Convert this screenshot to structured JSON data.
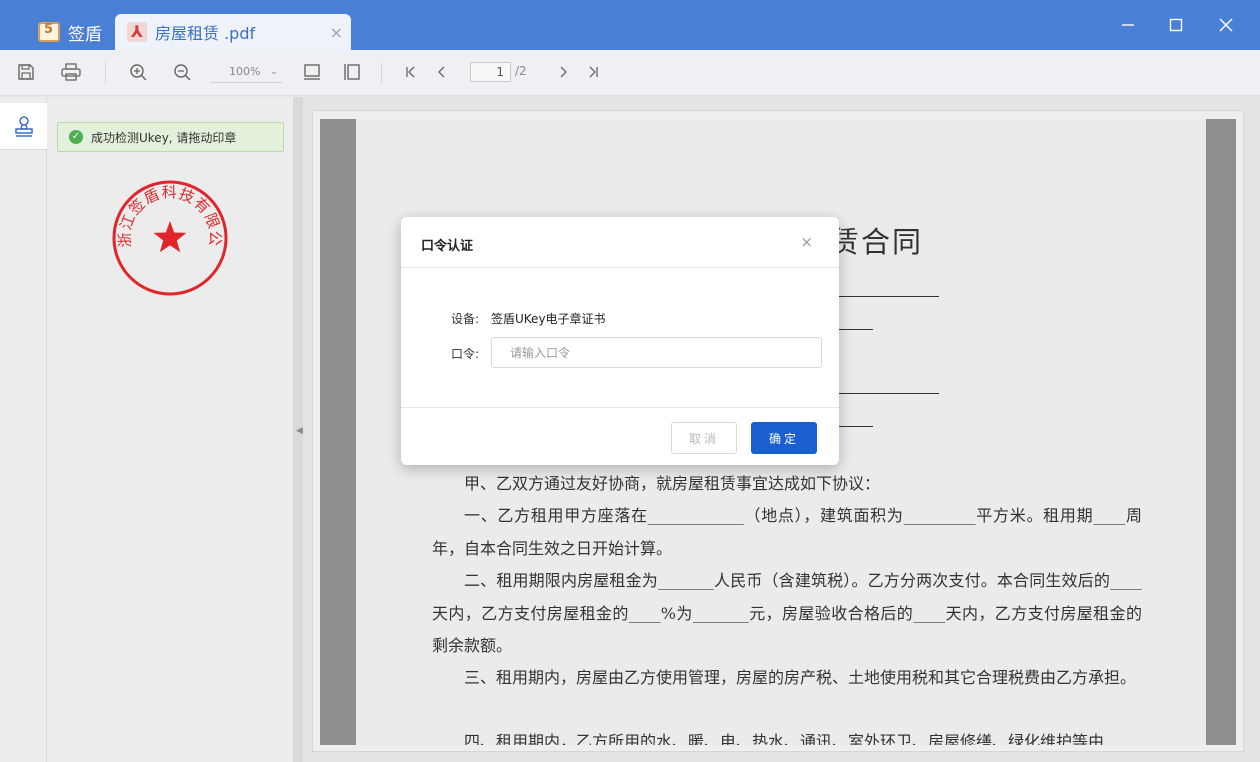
{
  "titlebar": {
    "app_name": "签盾",
    "tab_title": "房屋租赁 .pdf",
    "tab_close": "×",
    "minimize": "—",
    "maximize": "☐",
    "close": "✕"
  },
  "toolbar": {
    "zoom": "100%",
    "page_current": "1",
    "page_total": "/2",
    "icons": [
      "save-icon",
      "print-icon",
      "zoom-in-icon",
      "zoom-out-icon",
      "fit-width-icon",
      "fit-height-icon",
      "first-page-icon",
      "prev-page-icon",
      "next-page-icon",
      "last-page-icon"
    ]
  },
  "sidebar": {
    "alert": "成功检测Ukey, 请拖动印章",
    "seal_text": "浙江签盾科技有限公司",
    "seal_color": "#e0262b"
  },
  "document": {
    "title_fragment": "赁合同",
    "paragraphs": [
      "甲、乙双方通过友好协商，就房屋租赁事宜达成如下协议：",
      "一、乙方租用甲方座落在____________（地点），建筑面积为_________平方米。租用期____周年，自本合同生效之日开始计算。",
      "二、租用期限内房屋租金为_______人民币（含建筑税）。乙方分两次支付。本合同生效后的____天内，乙方支付房屋租金的____%为_______元，房屋验收合格后的____天内，乙方支付房屋租金的剩余款额。",
      "三、租用期内，房屋由乙方使用管理，房屋的房产税、土地使用税和其它合理税费由乙方承担。",
      "四、租用期内，乙方所用的水、暖、电、热水、通讯、室外环卫、房屋修缮、绿化维护等由"
    ]
  },
  "dialog": {
    "title": "口令认证",
    "close": "×",
    "device_label": "设备:",
    "device_value": "签盾UKey电子章证书",
    "password_label": "口令:",
    "password_placeholder": "请输入口令",
    "password_value": "",
    "cancel_label": "取消",
    "ok_label": "确定",
    "accent": "#1a5fd0"
  }
}
